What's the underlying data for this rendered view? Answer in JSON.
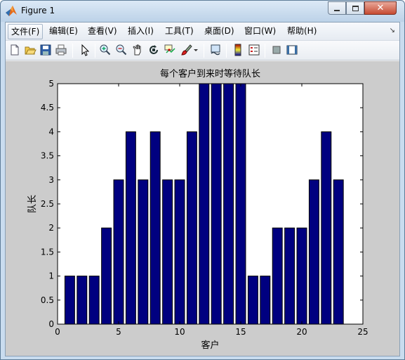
{
  "window": {
    "title": "Figure 1"
  },
  "menu": {
    "items": [
      {
        "label": "文件(F)"
      },
      {
        "label": "编辑(E)"
      },
      {
        "label": "查看(V)"
      },
      {
        "label": "插入(I)"
      },
      {
        "label": "工具(T)"
      },
      {
        "label": "桌面(D)"
      },
      {
        "label": "窗口(W)"
      },
      {
        "label": "帮助(H)"
      }
    ]
  },
  "toolbar": {
    "icons": [
      "new-figure-icon",
      "open-file-icon",
      "save-icon",
      "print-icon",
      "pointer-icon",
      "zoom-in-icon",
      "zoom-out-icon",
      "pan-icon",
      "rotate-icon",
      "data-cursor-icon",
      "brush-icon",
      "link-plot-icon",
      "colorbar-icon",
      "legend-icon",
      "hide-plot-tools-icon",
      "show-plot-tools-icon"
    ]
  },
  "colors": {
    "bar_fill": "#000080",
    "bar_edge": "#000000",
    "figure_bg": "#cccccc",
    "axes_bg": "#ffffff"
  },
  "chart_data": {
    "type": "bar",
    "title": "每个客户到来时等待队长",
    "xlabel": "客户",
    "ylabel": "队长",
    "x": [
      1,
      2,
      3,
      4,
      5,
      6,
      7,
      8,
      9,
      10,
      11,
      12,
      13,
      14,
      15,
      16,
      17,
      18,
      19,
      20,
      21,
      22,
      23
    ],
    "values": [
      1,
      1,
      1,
      2,
      3,
      4,
      3,
      4,
      3,
      3,
      4,
      5,
      5,
      5,
      5,
      1,
      1,
      2,
      2,
      2,
      3,
      4,
      3
    ],
    "xlim": [
      0,
      25
    ],
    "ylim": [
      0,
      5
    ],
    "xticks": [
      "0",
      "5",
      "10",
      "15",
      "20",
      "25"
    ],
    "yticks": [
      "0",
      "0.5",
      "1",
      "1.5",
      "2",
      "2.5",
      "3",
      "3.5",
      "4",
      "4.5",
      "5"
    ],
    "grid": false
  }
}
